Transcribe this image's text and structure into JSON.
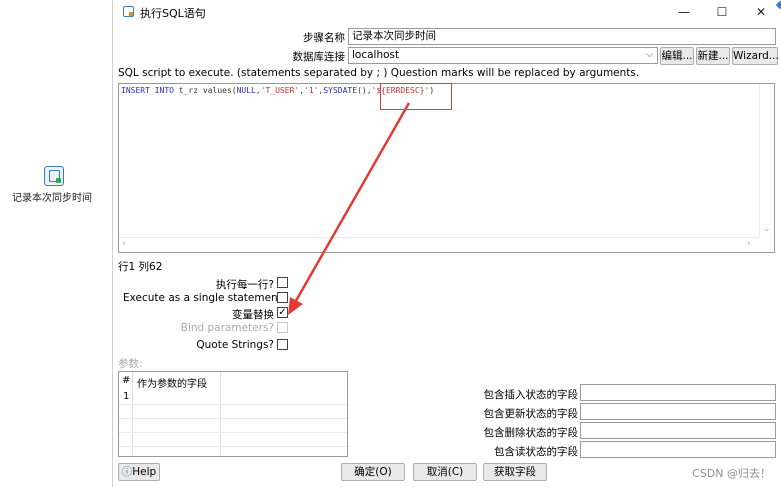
{
  "canvas": {
    "step_label": "记录本次同步时间"
  },
  "dialog": {
    "title": "执行SQL语句",
    "window_controls": {
      "minimize": "—",
      "maximize": "☐",
      "close": "✕"
    },
    "step_name": {
      "label": "步骤名称",
      "value": "记录本次同步时间"
    },
    "connection": {
      "label": "数据库连接",
      "value": "localhost"
    },
    "connection_buttons": {
      "edit": "编辑...",
      "new": "新建...",
      "wizard": "Wizard..."
    },
    "sql_description": "SQL script to execute. (statements separated by ; ) Question marks will be replaced by arguments.",
    "sql_code": {
      "kw1": "INSERT INTO",
      "plain1": " t_rz values(",
      "kw2": "NULL",
      "comma1": ",",
      "str1": "'T_USER'",
      "comma2": ",",
      "str2": "'1'",
      "comma3": ",",
      "kw3": "SYSDATE",
      "plain2": "(),",
      "str3": "'${ERRDESC}'",
      "plain3": ")"
    },
    "cursor_position": "行1 列62",
    "options": {
      "execute_each_row": {
        "label": "执行每一行?",
        "checked": ""
      },
      "single_statement": {
        "label": "Execute as a single statement",
        "checked": ""
      },
      "variable_substitution": {
        "label": "变量替换",
        "checked": "✓"
      },
      "bind_parameters": {
        "label": "Bind parameters?",
        "checked": ""
      },
      "quote_strings": {
        "label": "Quote Strings?",
        "checked": ""
      }
    },
    "params": {
      "label": "参数:",
      "columns": [
        "#",
        "作为参数的字段"
      ],
      "rows": [
        {
          "num": "1",
          "field": ""
        }
      ]
    },
    "status_fields": {
      "insert": {
        "label": "包含插入状态的字段",
        "value": ""
      },
      "update": {
        "label": "包含更新状态的字段",
        "value": ""
      },
      "delete": {
        "label": "包含删除状态的字段",
        "value": ""
      },
      "read": {
        "label": "包含读状态的字段",
        "value": ""
      }
    },
    "footer": {
      "help": "Help",
      "ok": "确定(O)",
      "cancel": "取消(C)",
      "get_fields": "获取字段"
    },
    "watermark": "CSDN @归去！"
  },
  "colors": {
    "annotation_red": "#e53935",
    "keyword_blue": "#2b2bcc",
    "string_red": "#c43131"
  }
}
